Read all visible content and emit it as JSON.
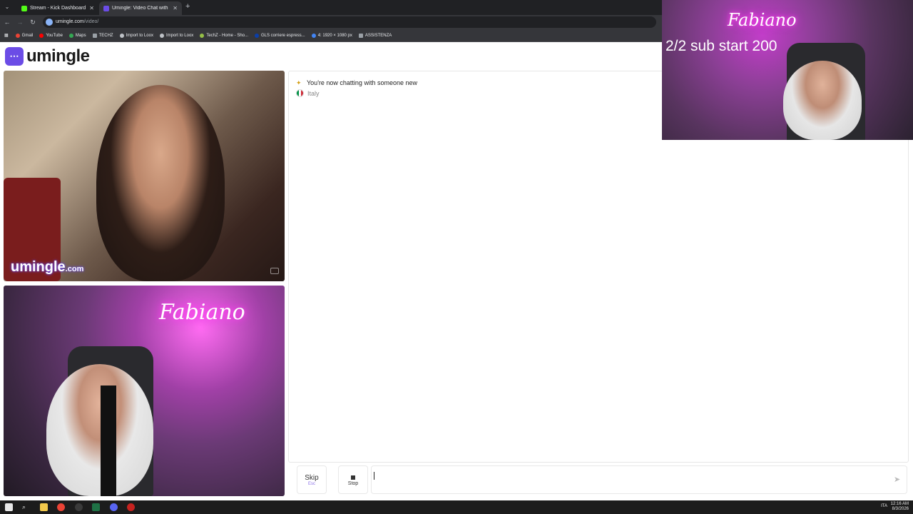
{
  "browser": {
    "tabs": [
      {
        "title": "Stream - Kick Dashboard",
        "active": false,
        "icon": "kick-icon"
      },
      {
        "title": "Umingle: Video Chat with S",
        "active": true,
        "icon": "umingle-icon"
      }
    ],
    "url_host": "umingle.com",
    "url_path": "/video/",
    "bookmarks": [
      {
        "label": "Gmail",
        "icon": "gmail-icon"
      },
      {
        "label": "YouTube",
        "icon": "youtube-icon"
      },
      {
        "label": "Maps",
        "icon": "maps-icon"
      },
      {
        "label": "TECHZ",
        "icon": "folder-icon"
      },
      {
        "label": "Import to Loox",
        "icon": "globe-icon"
      },
      {
        "label": "Import to Loox",
        "icon": "globe-icon"
      },
      {
        "label": "TechZ - Home - Sho...",
        "icon": "shopify-icon"
      },
      {
        "label": "GLS corriere espress...",
        "icon": "gls-icon"
      },
      {
        "label": "4: 1920 × 1080 px",
        "icon": "globe-icon"
      },
      {
        "label": "ASSISTENZA",
        "icon": "folder-icon"
      }
    ]
  },
  "site": {
    "logo_text": "umingle",
    "watermark": "umingle",
    "watermark_domain": ".com"
  },
  "chat": {
    "status": "You're now chatting with someone new",
    "country": "Italy"
  },
  "controls": {
    "skip_label": "Skip",
    "skip_hint": "Esc",
    "stop_label": "Stop",
    "message_value": ""
  },
  "overlay": {
    "text": "2/2 sub start 200",
    "neon_sign": "Fabiano"
  },
  "taskbar": {
    "language": "ITA",
    "time": "12:16 AM",
    "date": "8/3/2026"
  }
}
